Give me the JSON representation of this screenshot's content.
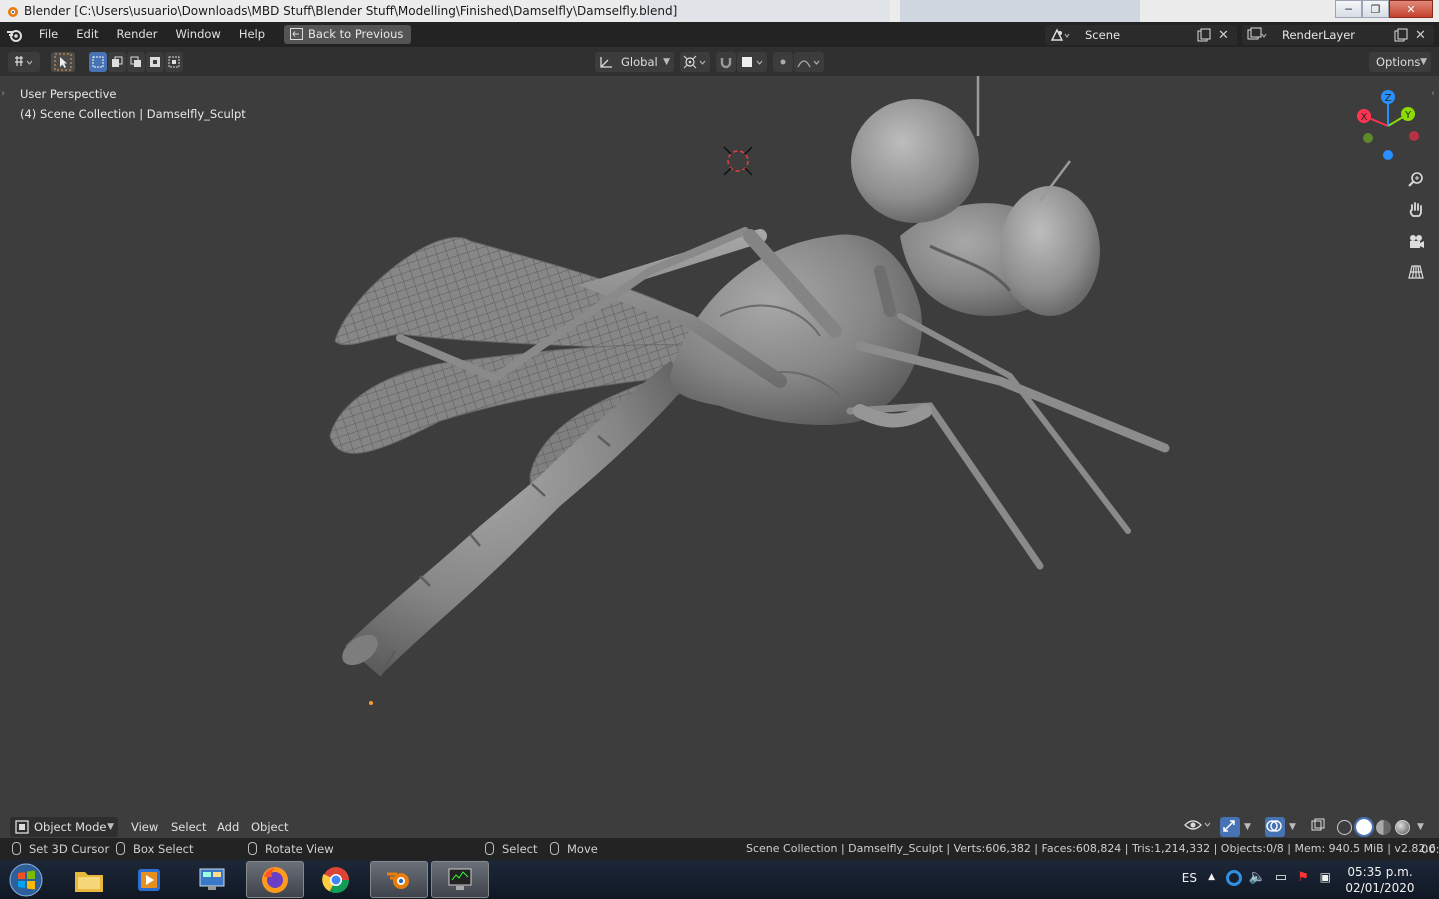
{
  "window": {
    "title": "Blender [C:\\Users\\usuario\\Downloads\\MBD Stuff\\Blender Stuff\\Modelling\\Finished\\Damselfly\\Damselfly.blend]",
    "controls": [
      "minimize",
      "maximize",
      "close"
    ]
  },
  "topbar": {
    "menus": [
      "File",
      "Edit",
      "Render",
      "Window",
      "Help"
    ],
    "back_button": "Back to Previous",
    "scene_label": "Scene",
    "renderlayer_label": "RenderLayer"
  },
  "header": {
    "transform_orientation": "Global",
    "options_label": "Options"
  },
  "viewport": {
    "view_name": "User Perspective",
    "collection_line": "(4) Scene Collection | Damselfly_Sculpt",
    "gizmo_axes": [
      "X",
      "Y",
      "Z"
    ]
  },
  "bottom_header": {
    "mode": "Object Mode",
    "menus": [
      "View",
      "Select",
      "Add",
      "Object"
    ]
  },
  "statusbar": {
    "hints": [
      {
        "icon": "mouse-left-icon",
        "label": "Set 3D Cursor"
      },
      {
        "icon": "mouse-middle-icon",
        "label": "Box Select"
      },
      {
        "icon": "mouse-right-icon",
        "label": "Rotate View"
      },
      {
        "icon": "mouse-left-icon",
        "label": "Select"
      },
      {
        "icon": "mouse-middle-icon",
        "label": "Move"
      }
    ],
    "stats": "Scene Collection | Damselfly_Sculpt | Verts:606,382 | Faces:608,824 | Tris:1,214,332 | Objects:0/8 | Mem: 940.5 MiB | v2.82.6",
    "time_fragment": "00:"
  },
  "taskbar": {
    "apps": [
      "start-orb",
      "file-explorer",
      "media-player",
      "control-panel",
      "firefox",
      "chrome",
      "blender",
      "system-monitor"
    ],
    "language": "ES",
    "time": "05:35 p.m.",
    "date": "02/01/2020"
  },
  "colors": {
    "accent": "#4772b3",
    "axis_x": "#ff3352",
    "axis_y": "#8bdc00",
    "axis_z": "#2890ff",
    "viewport_bg": "#3d3d3d"
  }
}
